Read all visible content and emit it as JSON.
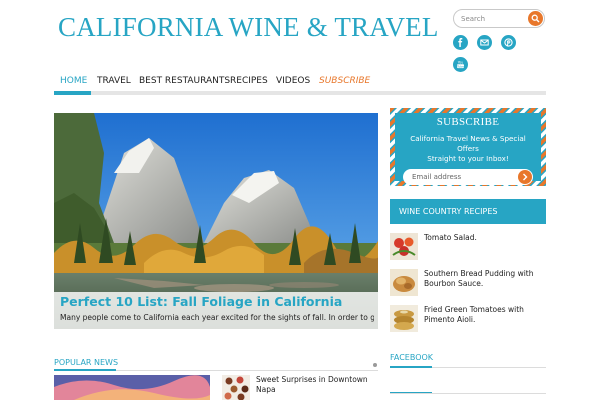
{
  "site": {
    "title": "CALIFORNIA WINE & TRAVEL"
  },
  "search": {
    "placeholder": "Search",
    "button_icon": "search-icon"
  },
  "social": [
    {
      "name": "facebook",
      "icon": "facebook-icon"
    },
    {
      "name": "email",
      "icon": "email-icon"
    },
    {
      "name": "pinterest",
      "icon": "pinterest-icon"
    },
    {
      "name": "youtube",
      "icon": "youtube-icon",
      "label": "You Tube"
    }
  ],
  "nav": {
    "items": [
      {
        "label": "HOME",
        "active": true
      },
      {
        "label": "TRAVEL",
        "active": false
      },
      {
        "label": "BEST RESTAURANTS",
        "active": false
      },
      {
        "label": "RECIPES",
        "active": false
      },
      {
        "label": "VIDEOS",
        "active": false
      },
      {
        "label": "SUBSCRIBE",
        "active": false
      }
    ]
  },
  "hero": {
    "title": "Perfect 10 List: Fall Foliage in California",
    "excerpt": "Many people come to California each year excited for the sights of fall. In order to get a..."
  },
  "popular": {
    "heading": "POPULAR NEWS",
    "items": [
      {
        "title": "Sweet Surprises in Downtown Napa"
      }
    ]
  },
  "subscribe": {
    "title": "SUBSCRIBE",
    "line1": "California Travel News & Special",
    "line2": "Offers",
    "line3": "Straight to your Inbox!",
    "email_placeholder": "Email address"
  },
  "wine_recipes": {
    "heading": "WINE COUNTRY RECIPES",
    "items": [
      {
        "title": "Tomato Salad."
      },
      {
        "title": "Southern Bread Pudding with Bourbon Sauce."
      },
      {
        "title": "Fried Green Tomatoes with Pimento Aioli."
      }
    ]
  },
  "facebook": {
    "heading": "FACEBOOK"
  },
  "colors": {
    "accent": "#27a5c4",
    "orange": "#e8772b"
  }
}
